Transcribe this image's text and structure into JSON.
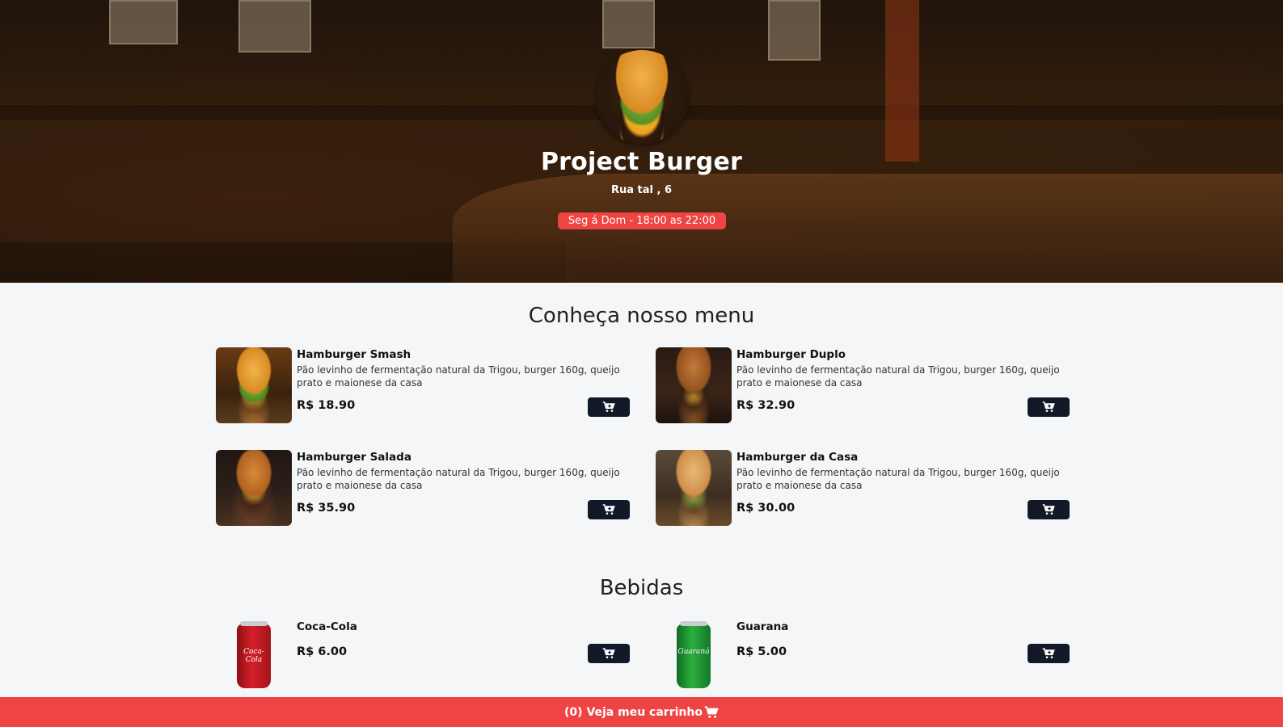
{
  "header": {
    "brand": "Project Burger",
    "address": "Rua tal , 6",
    "hours": "Seg á Dom - 18:00 as 22:00"
  },
  "menu": {
    "title": "Conheça nosso menu",
    "items": [
      {
        "name": "Hamburger Smash",
        "description": "Pão levinho de fermentação natural da Trigou, burger 160g, queijo prato e maionese da casa",
        "price": "R$ 18.90"
      },
      {
        "name": "Hamburger Duplo",
        "description": "Pão levinho de fermentação natural da Trigou, burger 160g, queijo prato e maionese da casa",
        "price": "R$ 32.90"
      },
      {
        "name": "Hamburger Salada",
        "description": "Pão levinho de fermentação natural da Trigou, burger 160g, queijo prato e maionese da casa",
        "price": "R$ 35.90"
      },
      {
        "name": "Hamburger da Casa",
        "description": "Pão levinho de fermentação natural da Trigou, burger 160g, queijo prato e maionese da casa",
        "price": "R$ 30.00"
      }
    ]
  },
  "drinks": {
    "title": "Bebidas",
    "items": [
      {
        "name": "Coca-Cola",
        "price": "R$ 6.00",
        "can_label": "Coca-Cola"
      },
      {
        "name": "Guarana",
        "price": "R$ 5.00",
        "can_label": "Guaraná"
      }
    ]
  },
  "footer": {
    "cart_label": "(0) Veja meu carrinho"
  },
  "colors": {
    "accent": "#ef4444",
    "button": "#111827",
    "background": "#f4f6f8"
  },
  "icons": {
    "cart": "cart-plus-icon",
    "footer_cart": "cart-icon"
  }
}
